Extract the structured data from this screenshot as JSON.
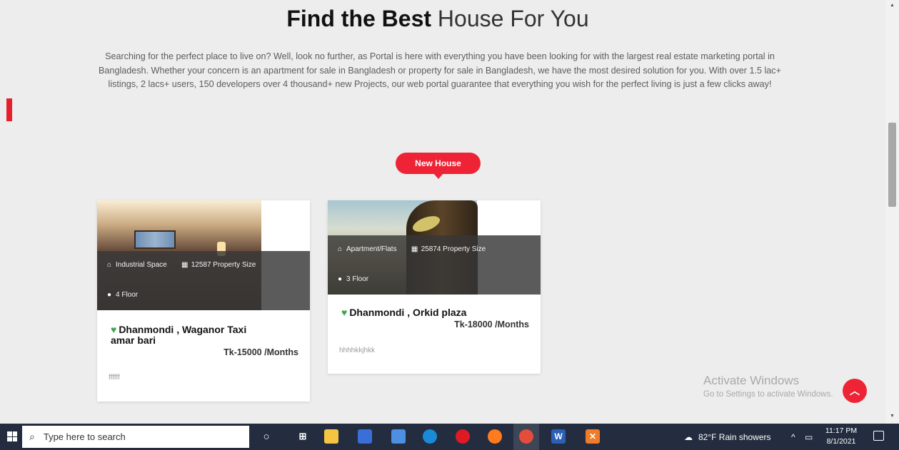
{
  "heading": {
    "bold": "Find the Best",
    "light": "House For You"
  },
  "intro": "Searching for the perfect place to live on? Well, look no further, as Portal is here with everything you have been looking for with the largest real estate marketing portal in Bangladesh. Whether your concern is an apartment for sale in Bangladesh or property for sale in Bangladesh, we have the most desired solution for you. With over 1.5 lac+ listings, 2 lacs+ users, 150 developers over 4 thousand+ new Projects, our web portal guarantee that everything you wish for the perfect living is just a few clicks away!",
  "badge": "New House",
  "listings": [
    {
      "type": "Industrial Space",
      "size": "12587 Property Size",
      "floor": "4 Floor",
      "location": "Dhanmondi , Waganor Taxi amar bari",
      "price": "Tk-15000 /Months",
      "description": "ffffff"
    },
    {
      "type": "Apartment/Flats",
      "size": "25874 Property Size",
      "floor": "3 Floor",
      "location": "Dhanmondi , Orkid plaza",
      "price": "Tk-18000 /Months",
      "description": "hhhhkkjhkk"
    }
  ],
  "watermark": {
    "title": "Activate Windows",
    "subtitle": "Go to Settings to activate Windows."
  },
  "taskbar": {
    "search_placeholder": "Type here to search",
    "weather": "82°F  Rain showers",
    "time": "11:17 PM",
    "date": "8/1/2021"
  },
  "colors": {
    "accent": "#ee2436",
    "pin": "#3fa34d",
    "taskbar": "#232d3f"
  }
}
